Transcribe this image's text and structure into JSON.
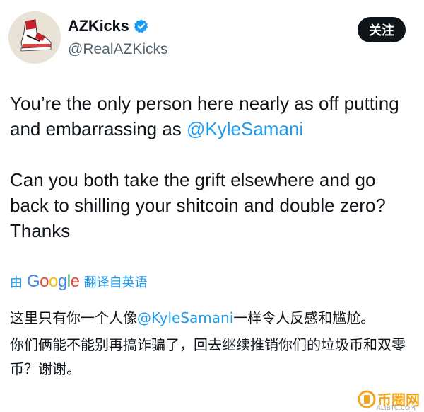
{
  "profile": {
    "display_name": "AZKicks",
    "handle": "@RealAZKicks",
    "avatar_icon": "sneaker-avatar-icon",
    "verified_icon": "verified-badge-icon",
    "verified_color": "#1d9bf0"
  },
  "follow_button": {
    "label": "关注"
  },
  "tweet": {
    "line1_text": "You’re the only person here nearly as off putting and embarrassing as ",
    "line1_mention": "@KyleSamani",
    "paragraph2": "Can you both take the grift elsewhere and go back to shilling your shitcoin and double zero? Thanks"
  },
  "translation": {
    "prefix": "由",
    "brand": "Google",
    "suffix": "翻译自英语",
    "p1_before": "这里只有你一个人像",
    "p1_mention": "@KyleSamani",
    "p1_after": "一样令人反感和尴尬。",
    "p2": "你们俩能不能别再搞诈骗了，回去继续推销你们的垃圾币和双零币？谢谢。"
  },
  "watermark": {
    "text": "币圈网",
    "sub": "ALIBTC.COM"
  },
  "colors": {
    "accent": "#1d9bf0",
    "text": "#0f1419",
    "muted": "#536471"
  }
}
